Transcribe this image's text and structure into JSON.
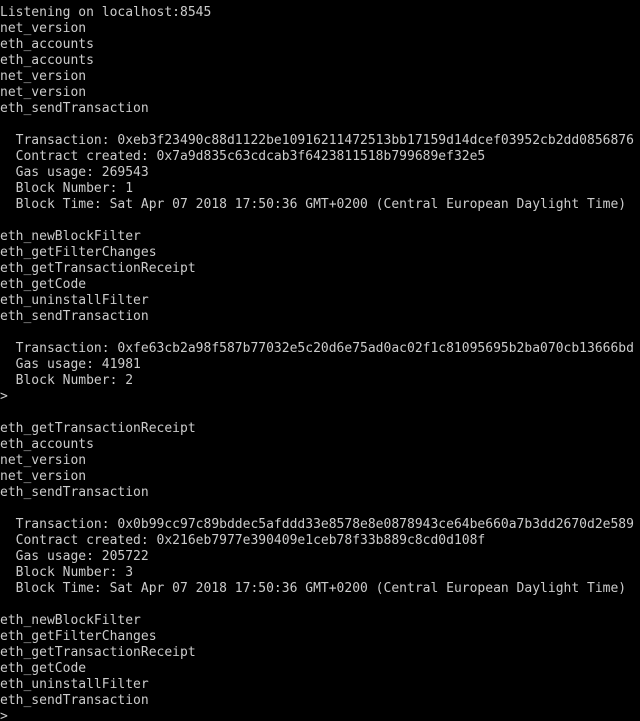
{
  "terminal": {
    "title": "Terminal",
    "background_color": "#000000",
    "text_color": "#cccccc",
    "font_size_px": 13,
    "line_height_px": 16,
    "prompt_symbol": ">",
    "server": {
      "listening_message": "Listening on localhost:8545",
      "host": "localhost",
      "port": "8545"
    },
    "lines": [
      "Listening on localhost:8545",
      "net_version",
      "eth_accounts",
      "eth_accounts",
      "net_version",
      "net_version",
      "eth_sendTransaction",
      "",
      "  Transaction: 0xeb3f23490c88d1122be10916211472513bb17159d14dcef03952cb2dd0856876",
      "  Contract created: 0x7a9d835c63cdcab3f6423811518b799689ef32e5",
      "  Gas usage: 269543",
      "  Block Number: 1",
      "  Block Time: Sat Apr 07 2018 17:50:36 GMT+0200 (Central European Daylight Time)",
      "",
      "eth_newBlockFilter",
      "eth_getFilterChanges",
      "eth_getTransactionReceipt",
      "eth_getCode",
      "eth_uninstallFilter",
      "eth_sendTransaction",
      "",
      "  Transaction: 0xfe63cb2a98f587b77032e5c20d6e75ad0ac02f1c81095695b2ba070cb13666bd",
      "  Gas usage: 41981",
      "  Block Number: 2",
      ">",
      "",
      "eth_getTransactionReceipt",
      "eth_accounts",
      "net_version",
      "net_version",
      "eth_sendTransaction",
      "",
      "  Transaction: 0x0b99cc97c89bddec5afddd33e8578e8e0878943ce64be660a7b3dd2670d2e589",
      "  Contract created: 0x216eb7977e390409e1ceb78f33b889c8cd0d108f",
      "  Gas usage: 205722",
      "  Block Number: 3",
      "  Block Time: Sat Apr 07 2018 17:50:36 GMT+0200 (Central European Daylight Time)",
      "",
      "eth_newBlockFilter",
      "eth_getFilterChanges",
      "eth_getTransactionReceipt",
      "eth_getCode",
      "eth_uninstallFilter",
      "eth_sendTransaction",
      ">"
    ],
    "rpc_methods": [
      "net_version",
      "eth_accounts",
      "eth_sendTransaction",
      "eth_newBlockFilter",
      "eth_getFilterChanges",
      "eth_getTransactionReceipt",
      "eth_getCode",
      "eth_uninstallFilter"
    ],
    "transactions": [
      {
        "hash_label": "Transaction:",
        "hash": "0xeb3f23490c88d1122be10916211472513bb17159d14dcef03952cb2dd0856876",
        "contract_label": "Contract created:",
        "contract": "0x7a9d835c63cdcab3f6423811518b799689ef32e5",
        "gas_label": "Gas usage:",
        "gas": "269543",
        "block_number_label": "Block Number:",
        "block_number": "1",
        "block_time_label": "Block Time:",
        "block_time": "Sat Apr 07 2018 17:50:36 GMT+0200 (Central European Daylight Time)"
      },
      {
        "hash_label": "Transaction:",
        "hash": "0xfe63cb2a98f587b77032e5c20d6e75ad0ac02f1c81095695b2ba070cb13666bd",
        "gas_label": "Gas usage:",
        "gas": "41981",
        "block_number_label": "Block Number:",
        "block_number": "2"
      },
      {
        "hash_label": "Transaction:",
        "hash": "0x0b99cc97c89bddec5afddd33e8578e8e0878943ce64be660a7b3dd2670d2e589",
        "contract_label": "Contract created:",
        "contract": "0x216eb7977e390409e1ceb78f33b889c8cd0d108f",
        "gas_label": "Gas usage:",
        "gas": "205722",
        "block_number_label": "Block Number:",
        "block_number": "3",
        "block_time_label": "Block Time:",
        "block_time": "Sat Apr 07 2018 17:50:36 GMT+0200 (Central European Daylight Time)"
      }
    ]
  }
}
